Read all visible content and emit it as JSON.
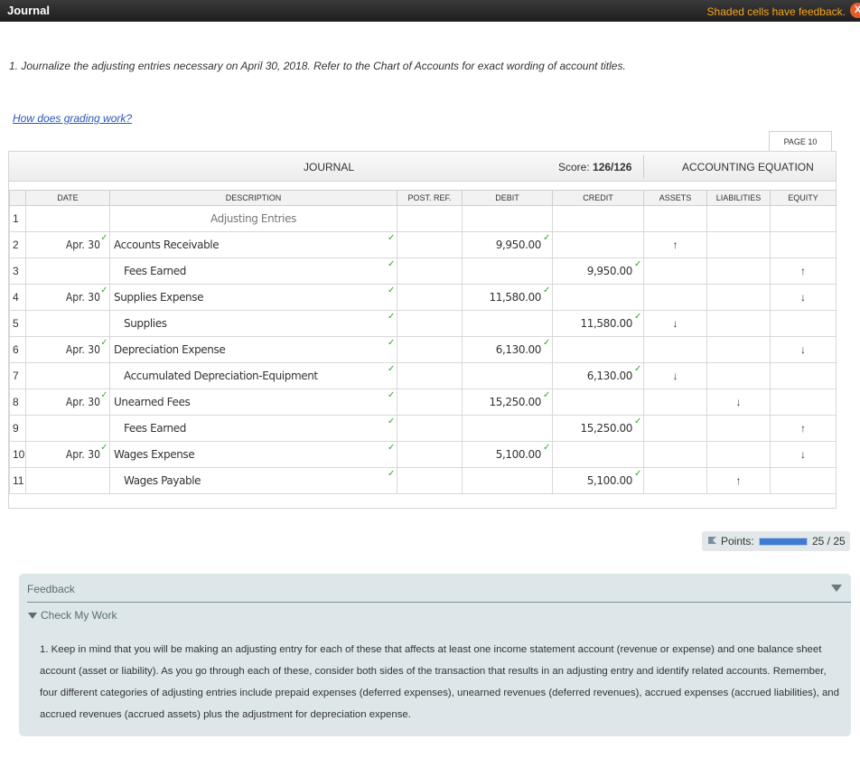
{
  "window": {
    "title": "Journal",
    "feedback_note": "Shaded cells have feedback.",
    "close_label": "X"
  },
  "instruction": "1. Journalize the adjusting entries necessary on April 30, 2018. Refer to the Chart of Accounts for exact wording of account titles.",
  "grading_link": "How does grading work?",
  "page_tab": "PAGE 10",
  "journal": {
    "title": "JOURNAL",
    "score_label": "Score:",
    "score_value": "126/126",
    "accounting_equation": "ACCOUNTING EQUATION",
    "columns": {
      "date": "DATE",
      "description": "DESCRIPTION",
      "post_ref": "POST. REF.",
      "debit": "DEBIT",
      "credit": "CREDIT",
      "assets": "ASSETS",
      "liabilities": "LIABILITIES",
      "equity": "EQUITY"
    },
    "rows": [
      {
        "n": "1",
        "date": "",
        "desc": "Adjusting Entries",
        "debit": "",
        "credit": "",
        "assets": "",
        "liabilities": "",
        "equity": ""
      },
      {
        "n": "2",
        "date": "Apr. 30",
        "desc": "Accounts Receivable",
        "debit": "9,950.00",
        "credit": "",
        "assets": "↑",
        "liabilities": "",
        "equity": ""
      },
      {
        "n": "3",
        "date": "",
        "desc": "Fees Earned",
        "debit": "",
        "credit": "9,950.00",
        "assets": "",
        "liabilities": "",
        "equity": "↑"
      },
      {
        "n": "4",
        "date": "Apr. 30",
        "desc": "Supplies Expense",
        "debit": "11,580.00",
        "credit": "",
        "assets": "",
        "liabilities": "",
        "equity": "↓"
      },
      {
        "n": "5",
        "date": "",
        "desc": "Supplies",
        "debit": "",
        "credit": "11,580.00",
        "assets": "↓",
        "liabilities": "",
        "equity": ""
      },
      {
        "n": "6",
        "date": "Apr. 30",
        "desc": "Depreciation Expense",
        "debit": "6,130.00",
        "credit": "",
        "assets": "",
        "liabilities": "",
        "equity": "↓"
      },
      {
        "n": "7",
        "date": "",
        "desc": "Accumulated Depreciation-Equipment",
        "debit": "",
        "credit": "6,130.00",
        "assets": "↓",
        "liabilities": "",
        "equity": ""
      },
      {
        "n": "8",
        "date": "Apr. 30",
        "desc": "Unearned Fees",
        "debit": "15,250.00",
        "credit": "",
        "assets": "",
        "liabilities": "↓",
        "equity": ""
      },
      {
        "n": "9",
        "date": "",
        "desc": "Fees Earned",
        "debit": "",
        "credit": "15,250.00",
        "assets": "",
        "liabilities": "",
        "equity": "↑"
      },
      {
        "n": "10",
        "date": "Apr. 30",
        "desc": "Wages Expense",
        "debit": "5,100.00",
        "credit": "",
        "assets": "",
        "liabilities": "",
        "equity": "↓"
      },
      {
        "n": "11",
        "date": "",
        "desc": "Wages Payable",
        "debit": "",
        "credit": "5,100.00",
        "assets": "",
        "liabilities": "↑",
        "equity": ""
      }
    ]
  },
  "points": {
    "label": "Points:",
    "value": "25 / 25",
    "fraction": 1.0
  },
  "feedback": {
    "title": "Feedback",
    "section": "Check My Work",
    "text": "1. Keep in mind that you will be making an adjusting entry for each of these that affects at least one income statement account (revenue or expense) and one balance sheet account (asset or liability). As you go through each of these, consider both sides of the transaction that results in an adjusting entry and identify related accounts. Remember, four different categories of adjusting entries include prepaid expenses (deferred expenses), unearned revenues (deferred revenues), accrued expenses (accrued liabilities), and accrued revenues (accrued assets) plus the adjustment for depreciation expense."
  },
  "colors": {
    "check": "#2fa52f",
    "feedback_note": "#f7a51c",
    "points_fill": "#3e7bd4",
    "feedback_bg": "#dde7ea"
  },
  "icons": {
    "check": "check-icon",
    "close": "close-icon",
    "flag": "flag-icon",
    "collapse": "chevron-down-icon"
  }
}
